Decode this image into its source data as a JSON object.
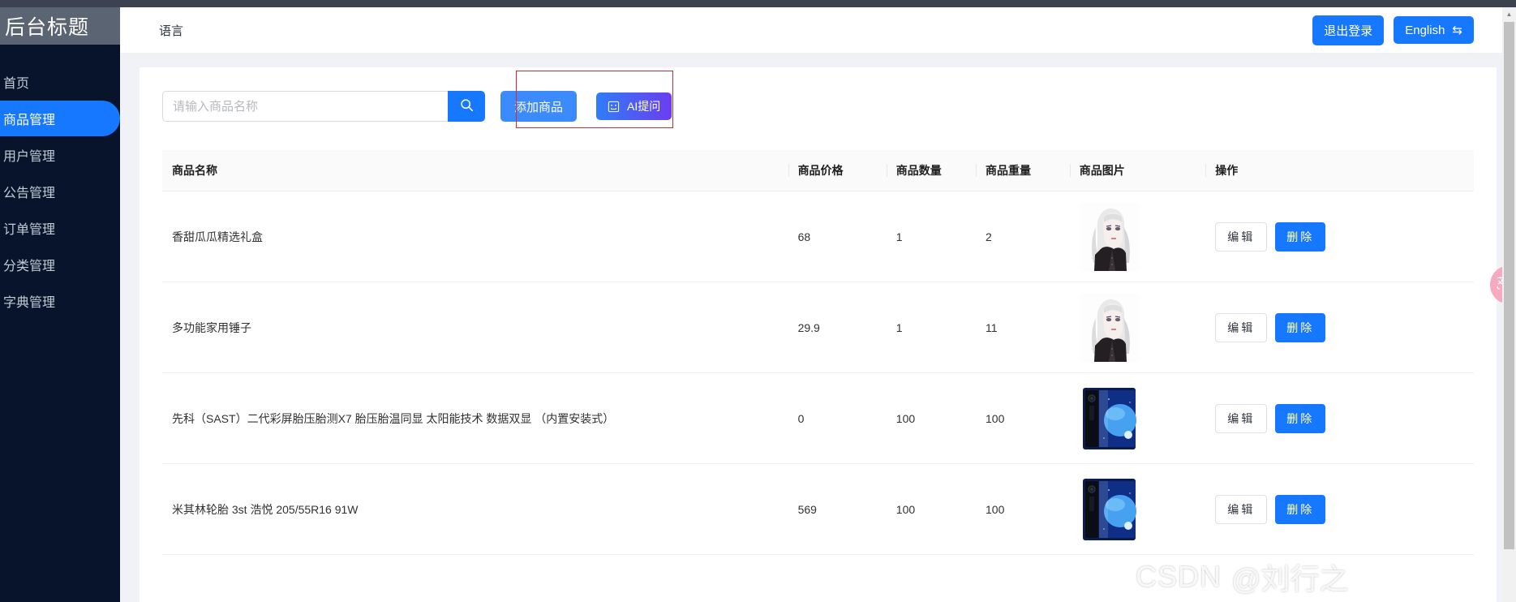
{
  "sidebar": {
    "brand": "后台标题",
    "items": [
      {
        "label": "首页",
        "active": false
      },
      {
        "label": "商品管理",
        "active": true
      },
      {
        "label": "用户管理",
        "active": false
      },
      {
        "label": "公告管理",
        "active": false
      },
      {
        "label": "订单管理",
        "active": false
      },
      {
        "label": "分类管理",
        "active": false
      },
      {
        "label": "字典管理",
        "active": false
      }
    ]
  },
  "header": {
    "title": "语言",
    "logout_label": "退出登录",
    "language_label": "English",
    "language_swap_glyph": "⇆"
  },
  "toolbar": {
    "search_placeholder": "请输入商品名称",
    "search_value": "",
    "search_icon": "search-icon",
    "add_label": "添加商品",
    "ai_label": "AI提问",
    "ai_icon": "robot-face-icon"
  },
  "table": {
    "columns": [
      "商品名称",
      "商品价格",
      "商品数量",
      "商品重量",
      "商品图片",
      "操作"
    ],
    "rows": [
      {
        "name": "香甜瓜瓜精选礼盒",
        "price": "68",
        "qty": "1",
        "weight": "2",
        "image": "anime-portrait",
        "edit": "编辑",
        "delete": "删除"
      },
      {
        "name": "多功能家用锤子",
        "price": "29.9",
        "qty": "1",
        "weight": "11",
        "image": "anime-portrait",
        "edit": "编辑",
        "delete": "删除"
      },
      {
        "name": "先科（SAST）二代彩屏胎压胎测X7 胎压胎温同显 太阳能技术 数据双显 （内置安装式）",
        "price": "0",
        "qty": "100",
        "weight": "100",
        "image": "blue-phone",
        "edit": "编辑",
        "delete": "删除"
      },
      {
        "name": "米其林轮胎 3st 浩悦 205/55R16 91W",
        "price": "569",
        "qty": "100",
        "weight": "100",
        "image": "blue-phone",
        "edit": "编辑",
        "delete": "删除"
      }
    ]
  },
  "translate_fab": {
    "icon": "translate-icon"
  },
  "watermark": {
    "brand": "CSDN",
    "user": "@刘行之"
  },
  "colors": {
    "sidebar_bg": "#07142b",
    "sidebar_active": "#1677ff",
    "primary": "#1677ff",
    "ai_gradient_start": "#2f7df8",
    "ai_gradient_end": "#6b3df0",
    "highlight_box": "#e0242c",
    "content_bg": "#f0f2f5",
    "fab_pink": "#f7a9c0"
  }
}
